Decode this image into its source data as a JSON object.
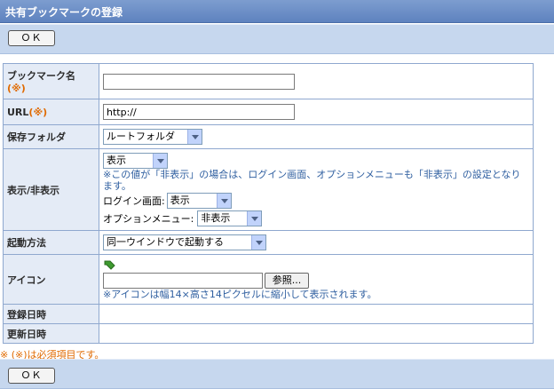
{
  "header": {
    "title": "共有ブックマークの登録"
  },
  "buttons": {
    "ok_label": "ＯＫ"
  },
  "form": {
    "bookmark_name": {
      "label": "ブックマーク名",
      "required_mark": "(※)",
      "value": ""
    },
    "url": {
      "label": "URL",
      "required_mark": "(※)",
      "value": "http://"
    },
    "folder": {
      "label": "保存フォルダ",
      "selected": "ルートフォルダ"
    },
    "visibility": {
      "label": "表示/非表示",
      "selected": "表示",
      "note": "※この値が「非表示」の場合は、ログイン画面、オプションメニューも「非表示」の設定となります。",
      "login_label": "ログイン画面:",
      "login_selected": "表示",
      "option_label": "オプションメニュー:",
      "option_selected": "非表示"
    },
    "launch": {
      "label": "起動方法",
      "selected": "同一ウインドウで起動する"
    },
    "icon": {
      "label": "アイコン",
      "file_value": "",
      "browse_label": "参照...",
      "note": "※アイコンは幅14×高さ14ピクセルに縮小して表示されます。"
    },
    "registered": {
      "label": "登録日時",
      "value": ""
    },
    "updated": {
      "label": "更新日時",
      "value": ""
    }
  },
  "footer": {
    "required_note": "※ (※)は必須項目です。"
  },
  "colors": {
    "header": "#6a8dc8",
    "button_bar": "#c6d7ee",
    "label_bg": "#e4ebf6",
    "required": "#e06a00",
    "note": "#2f5fa0"
  }
}
